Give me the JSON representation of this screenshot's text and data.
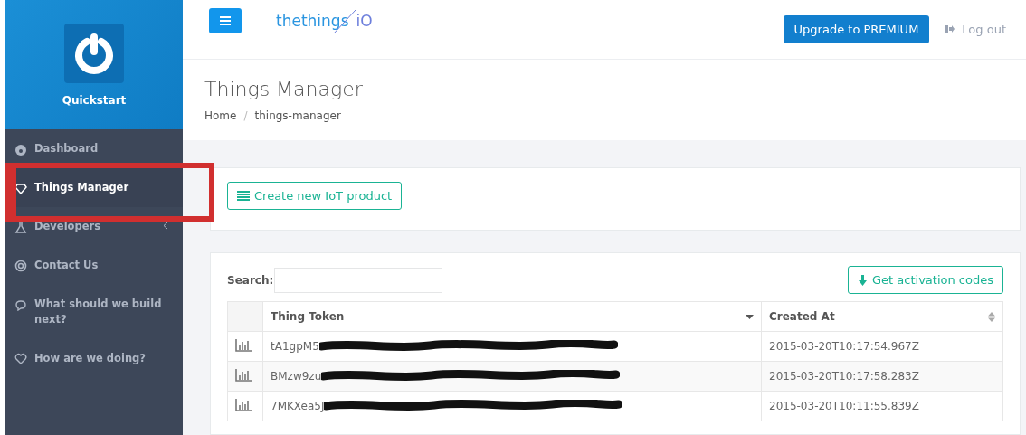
{
  "sidebar": {
    "title": "Quickstart",
    "items": [
      {
        "label": "Dashboard",
        "selected": false,
        "expandable": false
      },
      {
        "label": "Things Manager",
        "selected": true,
        "expandable": false
      },
      {
        "label": "Developers",
        "selected": false,
        "expandable": true
      },
      {
        "label": "Contact Us",
        "selected": false,
        "expandable": false
      },
      {
        "label": "What should we build next?",
        "selected": false,
        "expandable": false
      },
      {
        "label": "How are we doing?",
        "selected": false,
        "expandable": false
      }
    ]
  },
  "topbar": {
    "logo": "thethings",
    "logo_suffix": "iO",
    "upgrade_button": "Upgrade to PREMIUM",
    "logout": "Log out"
  },
  "page": {
    "title": "Things Manager",
    "breadcrumb": [
      "Home",
      "things-manager"
    ],
    "breadcrumb_separator": "/"
  },
  "create_button": "Create new IoT product",
  "table": {
    "search_label": "Search:",
    "activation_button": "Get activation codes",
    "columns": [
      "Thing Token",
      "Created At"
    ],
    "rows": [
      {
        "token": "tA1gpM5",
        "created": "2015-03-20T10:17:54.967Z"
      },
      {
        "token": "BMzw9zu",
        "created": "2015-03-20T10:17:58.283Z"
      },
      {
        "token": "7MKXea5J",
        "created": "2015-03-20T10:11:55.839Z"
      }
    ]
  }
}
